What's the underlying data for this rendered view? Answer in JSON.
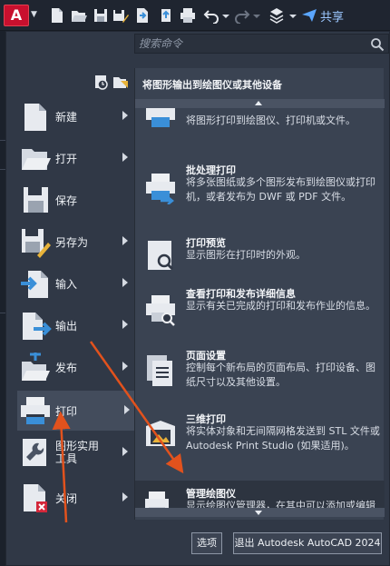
{
  "toolbar": {
    "app_letter": "A",
    "share_label": "共享"
  },
  "search": {
    "placeholder": "搜索命令"
  },
  "left_menu": {
    "items": [
      {
        "label": "新建",
        "icon": "new-doc-icon",
        "has_arrow": true
      },
      {
        "label": "打开",
        "icon": "folder-open-icon",
        "has_arrow": true
      },
      {
        "label": "保存",
        "icon": "save-icon",
        "has_arrow": false
      },
      {
        "label": "另存为",
        "icon": "save-as-icon",
        "has_arrow": true
      },
      {
        "label": "输入",
        "icon": "import-icon",
        "has_arrow": true
      },
      {
        "label": "输出",
        "icon": "export-icon",
        "has_arrow": true
      },
      {
        "label": "发布",
        "icon": "publish-icon",
        "has_arrow": true
      },
      {
        "label": "打印",
        "icon": "print-icon",
        "has_arrow": true,
        "active": true
      },
      {
        "label": "图形实用\n工具",
        "icon": "wrench-icon",
        "has_arrow": true
      },
      {
        "label": "关闭",
        "icon": "close-doc-icon",
        "has_arrow": true
      }
    ]
  },
  "right_panel": {
    "title": "将图形输出到绘图仪或其他设备",
    "items": [
      {
        "title": "",
        "desc": "将图形打印到绘图仪、打印机或文件。",
        "icon": "plot-icon"
      },
      {
        "title": "批处理打印",
        "desc": "将多张图纸或多个图形发布到绘图仪或打印机，或者发布为 DWF 或 PDF 文件。",
        "icon": "batch-plot-icon"
      },
      {
        "title": "打印预览",
        "desc": "显示图形在打印时的外观。",
        "icon": "plot-preview-icon"
      },
      {
        "title": "查看打印和发布详细信息",
        "desc": "显示有关已完成的打印和发布作业的信息。",
        "icon": "plot-details-icon"
      },
      {
        "title": "页面设置",
        "desc": "控制每个新布局的页面布局、打印设备、图纸尺寸以及其他设置。",
        "icon": "page-setup-icon"
      },
      {
        "title": "三维打印",
        "desc": "将实体对象和无间隔网格发送到 STL 文件或 Autodesk Print Studio (如果适用)。",
        "icon": "3d-print-icon"
      },
      {
        "title": "管理绘图仪",
        "desc": "显示绘图仪管理器，在其中可以添加或编辑绘图仪配置。",
        "icon": "manage-plotters-icon",
        "highlighted": true
      }
    ]
  },
  "buttons": {
    "options": "选项",
    "exit": "退出 Autodesk AutoCAD 2024"
  },
  "colors": {
    "app_red": "#c8102e",
    "annotation_arrow": "#e2521d",
    "share_blue": "#9cc7ff"
  }
}
